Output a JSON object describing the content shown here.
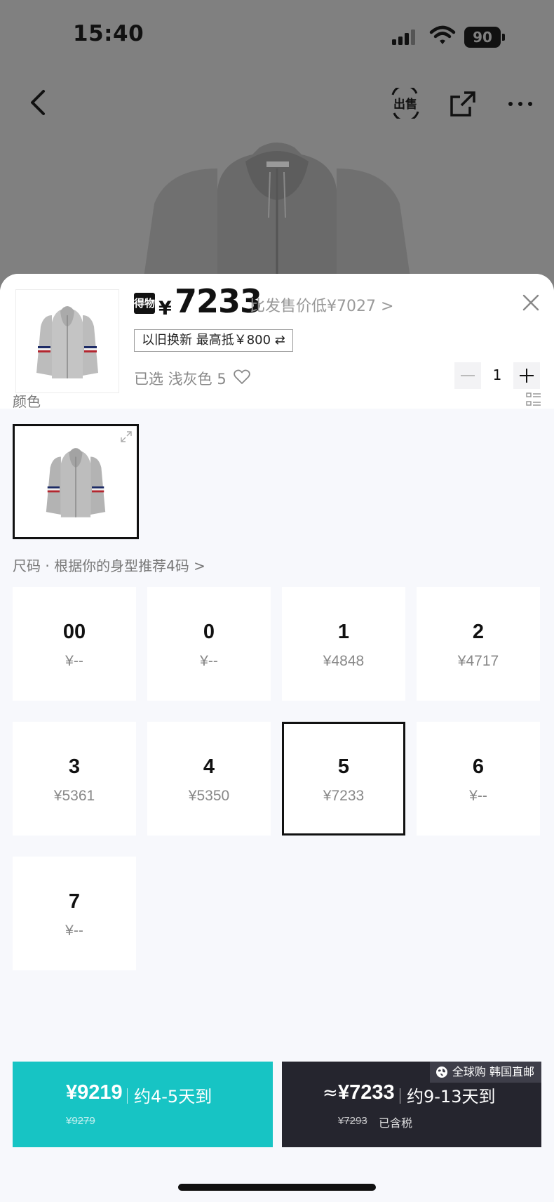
{
  "status_bar": {
    "time": "15:40",
    "battery": "90"
  },
  "nav": {
    "sell_label": "出售"
  },
  "product": {
    "brand_badge": "得物",
    "currency": "¥",
    "price": "7233",
    "compare_text": "比发售价低¥7027 >",
    "trade_in": "以旧换新 最高抵￥800 ⇄",
    "selected": "已选 浅灰色 5",
    "quantity": "1"
  },
  "color_section": {
    "label": "颜色"
  },
  "size_section": {
    "label": "尺码 · 根据你的身型推荐4码 >",
    "selected_size": "5",
    "sizes": [
      {
        "name": "00",
        "price": "¥--"
      },
      {
        "name": "0",
        "price": "¥--"
      },
      {
        "name": "1",
        "price": "¥4848"
      },
      {
        "name": "2",
        "price": "¥4717"
      },
      {
        "name": "3",
        "price": "¥5361"
      },
      {
        "name": "4",
        "price": "¥5350"
      },
      {
        "name": "5",
        "price": "¥7233"
      },
      {
        "name": "6",
        "price": "¥--"
      },
      {
        "name": "7",
        "price": "¥--"
      }
    ]
  },
  "buy_options": {
    "left": {
      "price": "¥9219",
      "eta": "约4-5天到",
      "original": "¥9279"
    },
    "right": {
      "approx": "≈",
      "price": "¥7233",
      "eta": "约9-13天到",
      "original": "¥7293",
      "tax": "已含税",
      "badge": "全球购 韩国直邮"
    }
  },
  "colors": {
    "teal": "#17c4c4",
    "dark": "#25252e"
  }
}
